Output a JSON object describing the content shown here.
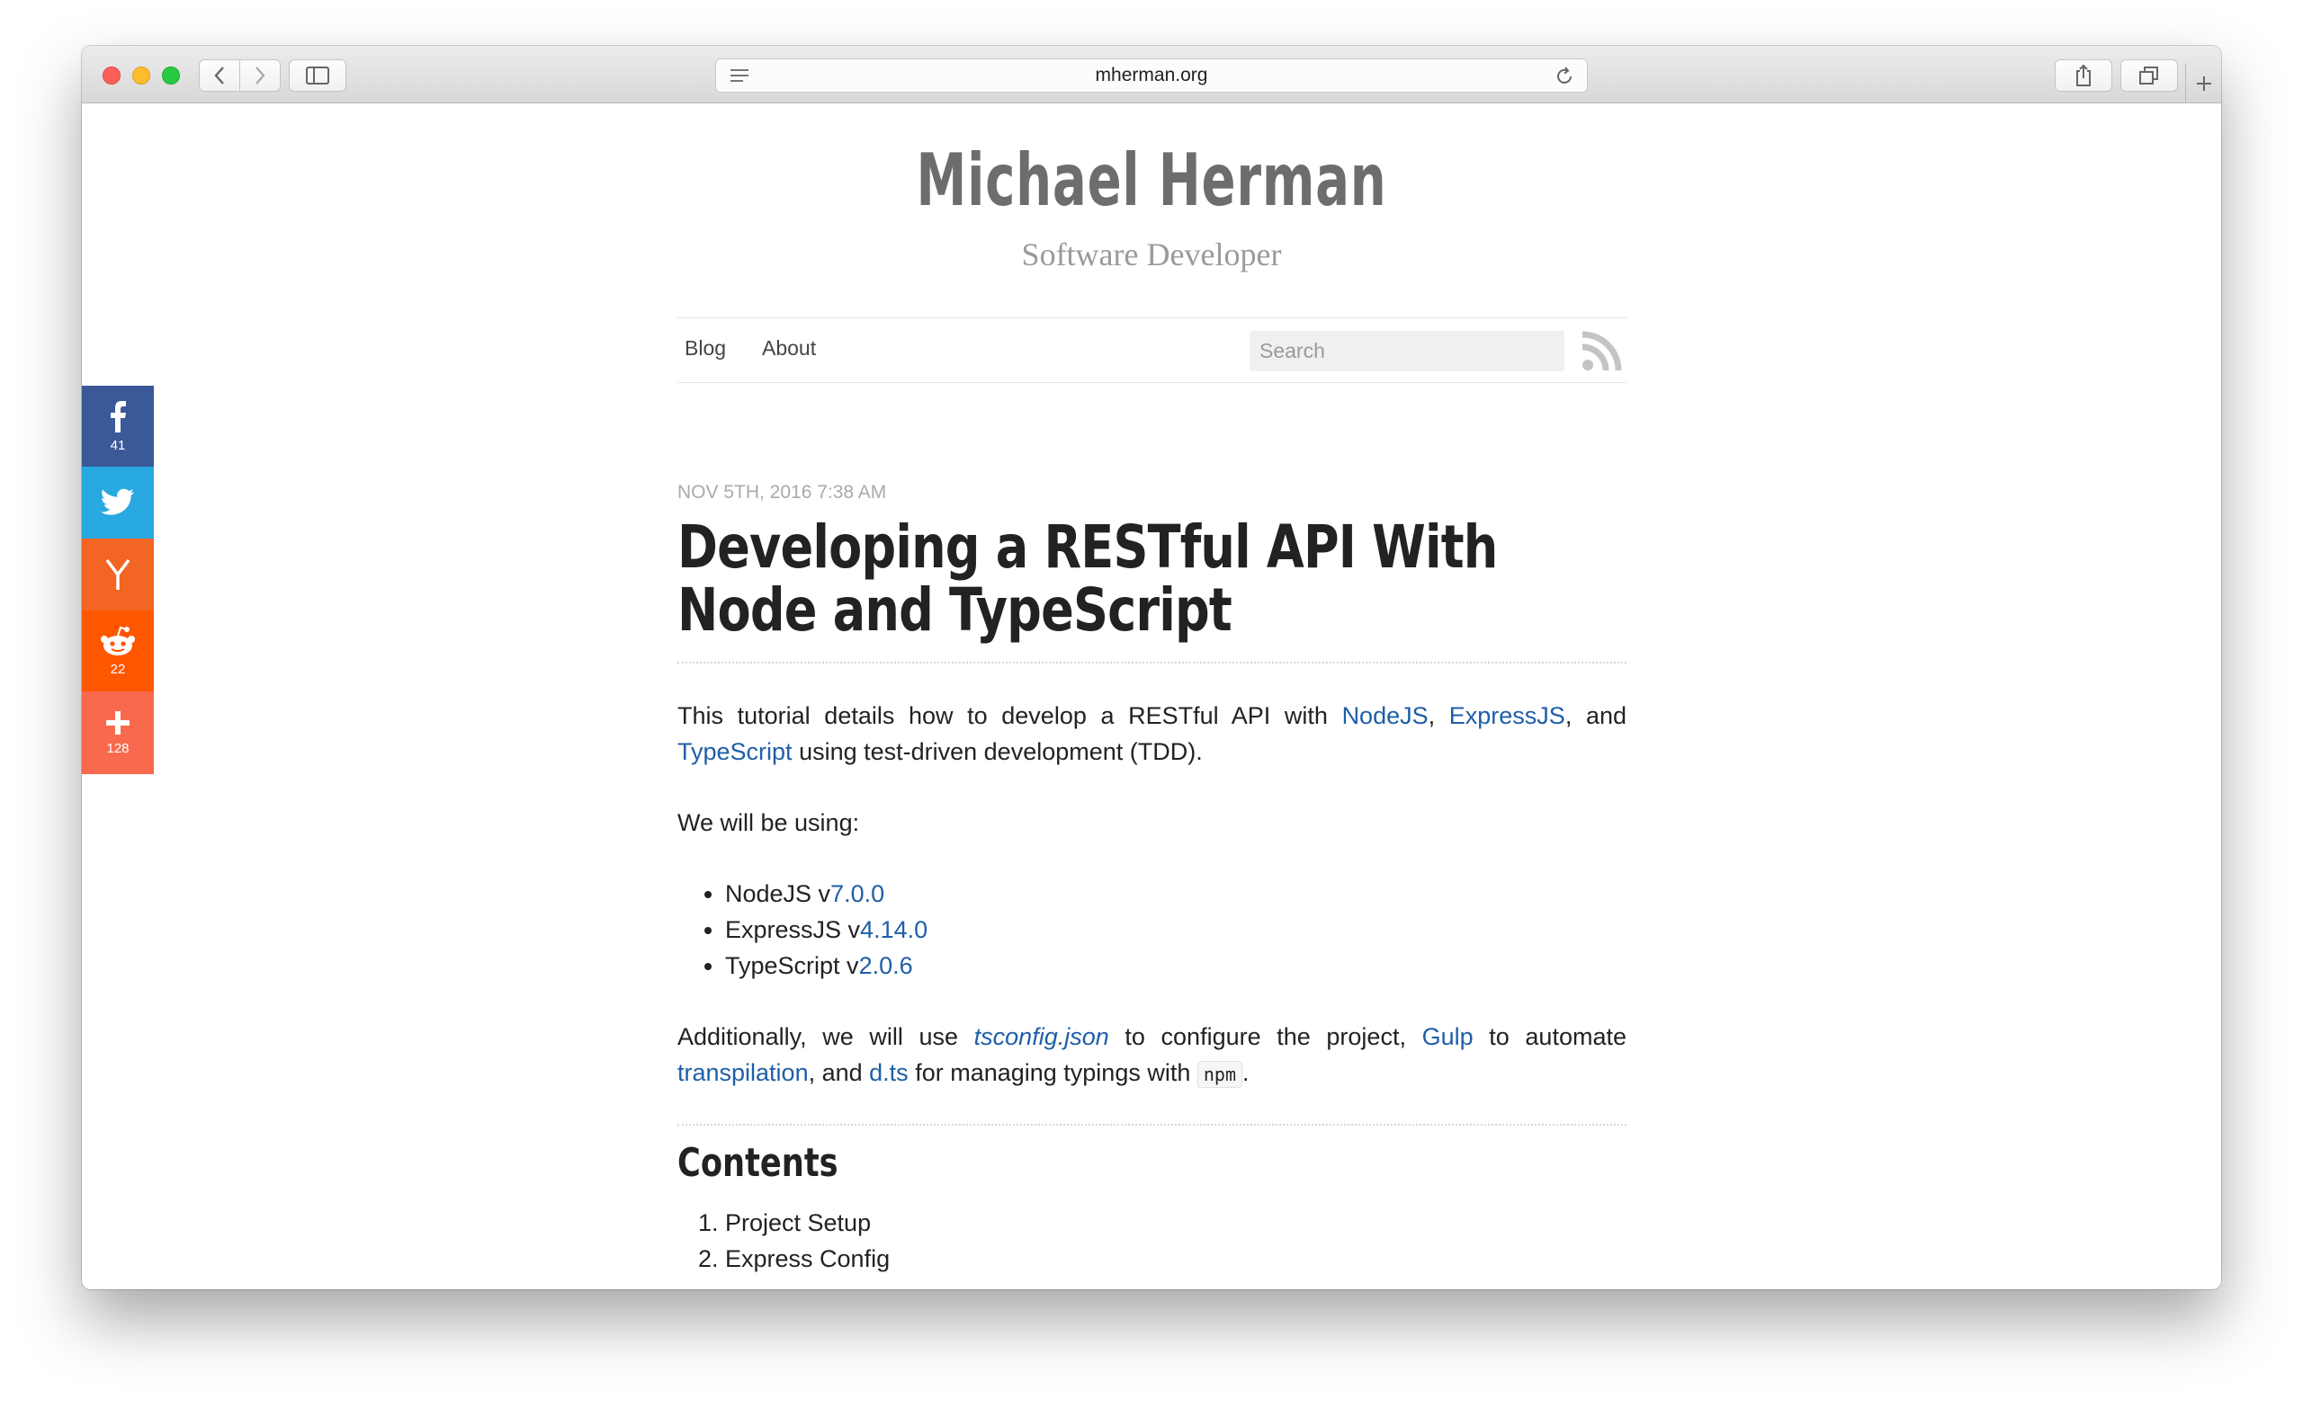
{
  "browser": {
    "url": "mherman.org"
  },
  "site": {
    "title": "Michael Herman",
    "subtitle": "Software Developer",
    "nav": [
      {
        "label": "Blog"
      },
      {
        "label": "About"
      }
    ],
    "search_placeholder": "Search"
  },
  "share": {
    "facebook_count": "41",
    "reddit_count": "22",
    "more_count": "128",
    "colors": {
      "facebook": "#3b5998",
      "twitter": "#29a9e1",
      "hackernews": "#f26522",
      "reddit": "#ff5700",
      "more": "#f8694d"
    }
  },
  "post": {
    "date": "NOV 5TH, 2016 7:38 AM",
    "title": "Developing a RESTful API With Node and TypeScript",
    "intro": {
      "t1": "This tutorial details how to develop a RESTful API with ",
      "l1": "NodeJS",
      "t2": ", ",
      "l2": "ExpressJS",
      "t3": ", and ",
      "l3": "TypeScript",
      "t4": " using test-driven development (TDD)."
    },
    "using_text": "We will be using:",
    "versions": [
      {
        "name": "NodeJS v",
        "version": "7.0.0"
      },
      {
        "name": "ExpressJS v",
        "version": "4.14.0"
      },
      {
        "name": "TypeScript v",
        "version": "2.0.6"
      }
    ],
    "additional": {
      "t1": "Additionally, we will use ",
      "l1": "tsconfig.json",
      "t2": " to configure the project, ",
      "l2": "Gulp",
      "t3": " to automate ",
      "l3": "transpilation",
      "t4": ", and ",
      "l4": "d.ts",
      "t5": " for managing typings with ",
      "code": "npm",
      "t6": "."
    },
    "contents_heading": "Contents",
    "contents": [
      "Project Setup",
      "Express Config"
    ]
  }
}
